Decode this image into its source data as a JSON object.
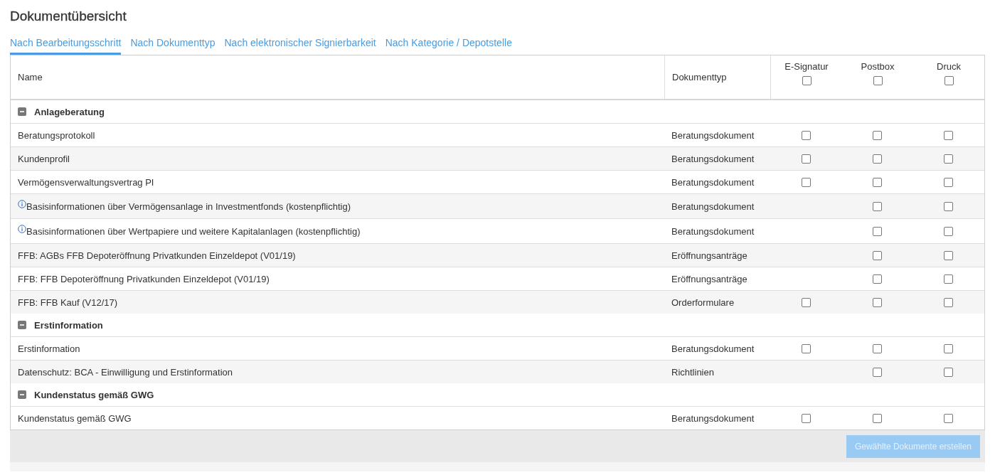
{
  "title": "Dokumentübersicht",
  "tabs": [
    {
      "label": "Nach Bearbeitungsschritt",
      "selected": true
    },
    {
      "label": "Nach Dokumenttyp",
      "selected": false
    },
    {
      "label": "Nach elektronischer Signierbarkeit",
      "selected": false
    },
    {
      "label": "Nach Kategorie / Depotstelle",
      "selected": false
    }
  ],
  "table": {
    "columns": {
      "name": "Name",
      "type": "Dokumenttyp",
      "e_signatur": {
        "label": "E-Signatur",
        "checked": false
      },
      "postbox": {
        "label": "Postbox",
        "checked": false
      },
      "druck": {
        "label": "Druck",
        "checked": false
      }
    },
    "groups": [
      {
        "label": "Anlageberatung",
        "expanded": true,
        "rows": [
          {
            "name": "Beratungsprotokoll",
            "type": "Beratungsdokument",
            "info": false,
            "e_signatur": {
              "checked": false
            },
            "postbox": {
              "checked": false
            },
            "druck": {
              "checked": false
            }
          },
          {
            "name": "Kundenprofil",
            "type": "Beratungsdokument",
            "info": false,
            "e_signatur": {
              "checked": false
            },
            "postbox": {
              "checked": false
            },
            "druck": {
              "checked": false
            }
          },
          {
            "name": "Vermögensverwaltungsvertrag PI",
            "type": "Beratungsdokument",
            "info": false,
            "e_signatur": {
              "checked": false
            },
            "postbox": {
              "checked": false
            },
            "druck": {
              "checked": false
            }
          },
          {
            "name": "Basisinformationen über Vermögensanlage in Investmentfonds (kostenpflichtig)",
            "type": "Beratungsdokument",
            "info": true,
            "postbox": {
              "checked": false
            },
            "druck": {
              "checked": false
            }
          },
          {
            "name": "Basisinformationen über Wertpapiere und weitere Kapitalanlagen (kostenpflichtig)",
            "type": "Beratungsdokument",
            "info": true,
            "postbox": {
              "checked": false
            },
            "druck": {
              "checked": false
            }
          },
          {
            "name": "FFB: AGBs FFB Depoteröffnung Privatkunden Einzeldepot (V01/19)",
            "type": "Eröffnungsanträge",
            "info": false,
            "postbox": {
              "checked": false
            },
            "druck": {
              "checked": false
            }
          },
          {
            "name": "FFB: FFB Depoteröffnung Privatkunden Einzeldepot (V01/19)",
            "type": "Eröffnungsanträge",
            "info": false,
            "postbox": {
              "checked": false
            },
            "druck": {
              "checked": false
            }
          },
          {
            "name": "FFB: FFB Kauf (V12/17)",
            "type": "Orderformulare",
            "info": false,
            "e_signatur": {
              "checked": false
            },
            "postbox": {
              "checked": false
            },
            "druck": {
              "checked": false
            }
          }
        ]
      },
      {
        "label": "Erstinformation",
        "expanded": true,
        "rows": [
          {
            "name": "Erstinformation",
            "type": "Beratungsdokument",
            "info": false,
            "e_signatur": {
              "checked": false
            },
            "postbox": {
              "checked": false
            },
            "druck": {
              "checked": false
            }
          },
          {
            "name": "Datenschutz: BCA - Einwilligung und Erstinformation",
            "type": "Richtlinien",
            "info": false,
            "postbox": {
              "checked": false
            },
            "druck": {
              "checked": false
            }
          }
        ]
      },
      {
        "label": "Kundenstatus gemäß GWG",
        "expanded": true,
        "rows": [
          {
            "name": "Kundenstatus gemäß GWG",
            "type": "Beratungsdokument",
            "info": false,
            "e_signatur": {
              "checked": false
            },
            "postbox": {
              "checked": false
            },
            "druck": {
              "checked": false
            }
          }
        ]
      }
    ]
  },
  "create_button": {
    "label": "Gewählte Dokumente erstellen",
    "disabled": true
  }
}
